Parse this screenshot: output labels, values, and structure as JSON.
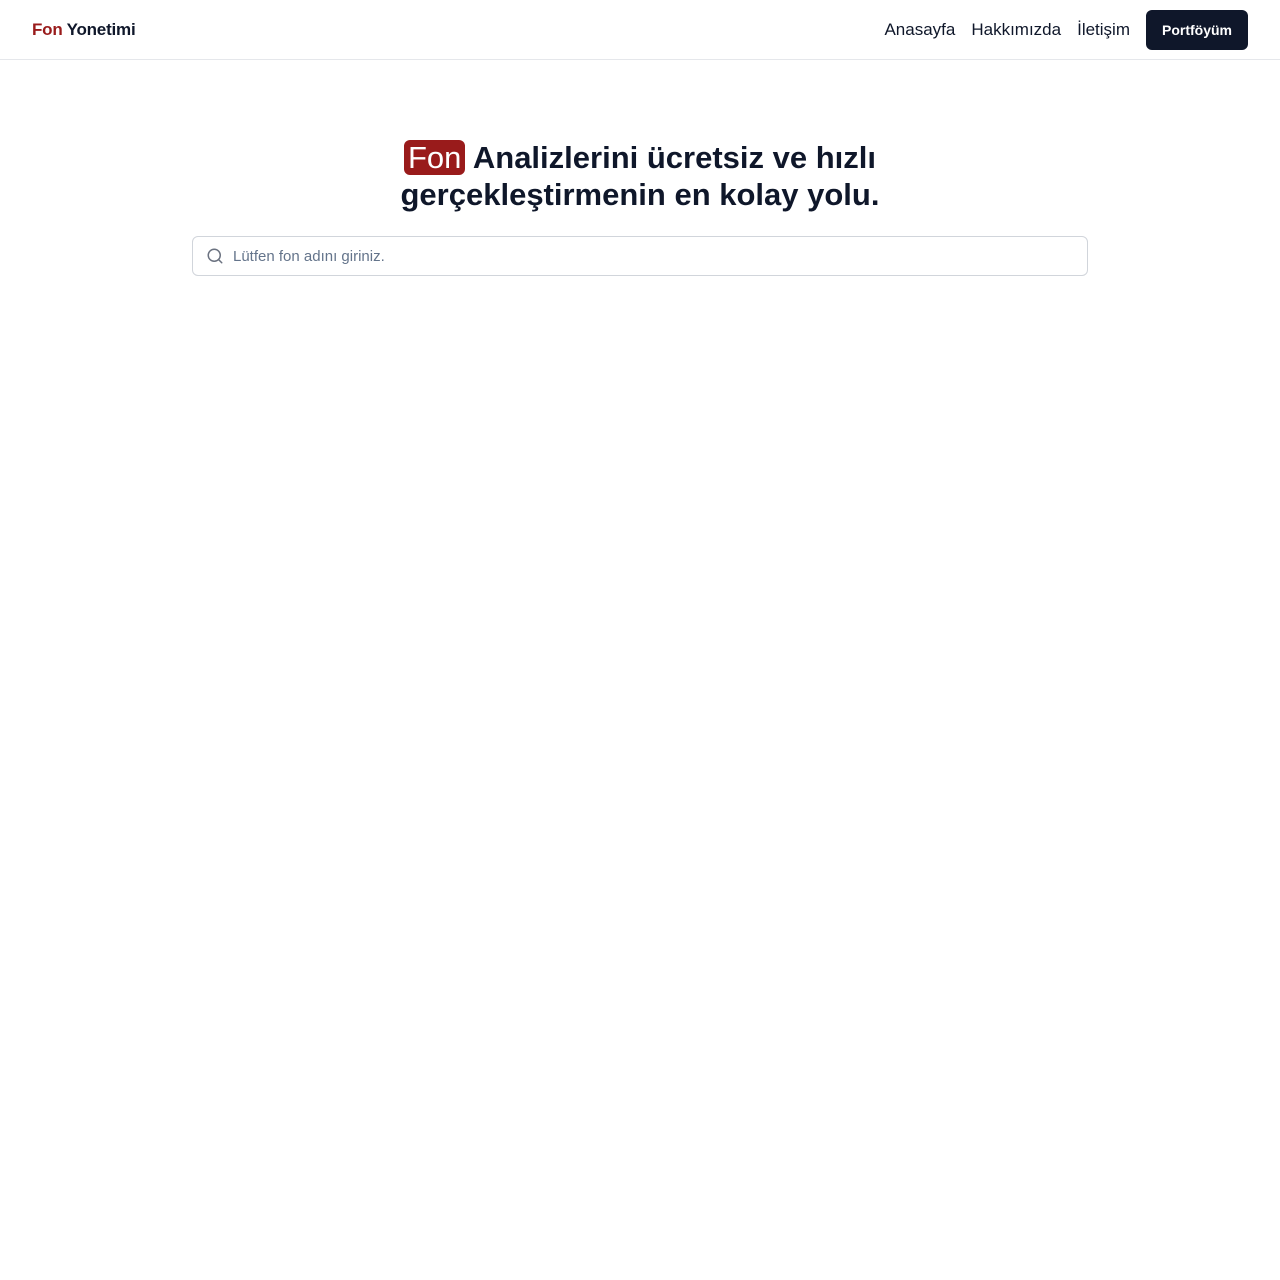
{
  "brand": {
    "accent_word": "Fon",
    "rest_word": "Yonetimi",
    "accent_color": "#991b1b"
  },
  "nav": {
    "links": [
      {
        "label": "Anasayfa"
      },
      {
        "label": "Hakkımızda"
      },
      {
        "label": "İletişim"
      }
    ],
    "portfolio_label": "Portföyüm"
  },
  "hero": {
    "highlight": "Fon",
    "title_line1_rest": " Analizlerini ücretsiz ve hızlı",
    "title_line2": "gerçekleştirmenin en kolay yolu."
  },
  "search": {
    "placeholder": "Lütfen fon adını giriniz.",
    "icon": "search-icon"
  }
}
